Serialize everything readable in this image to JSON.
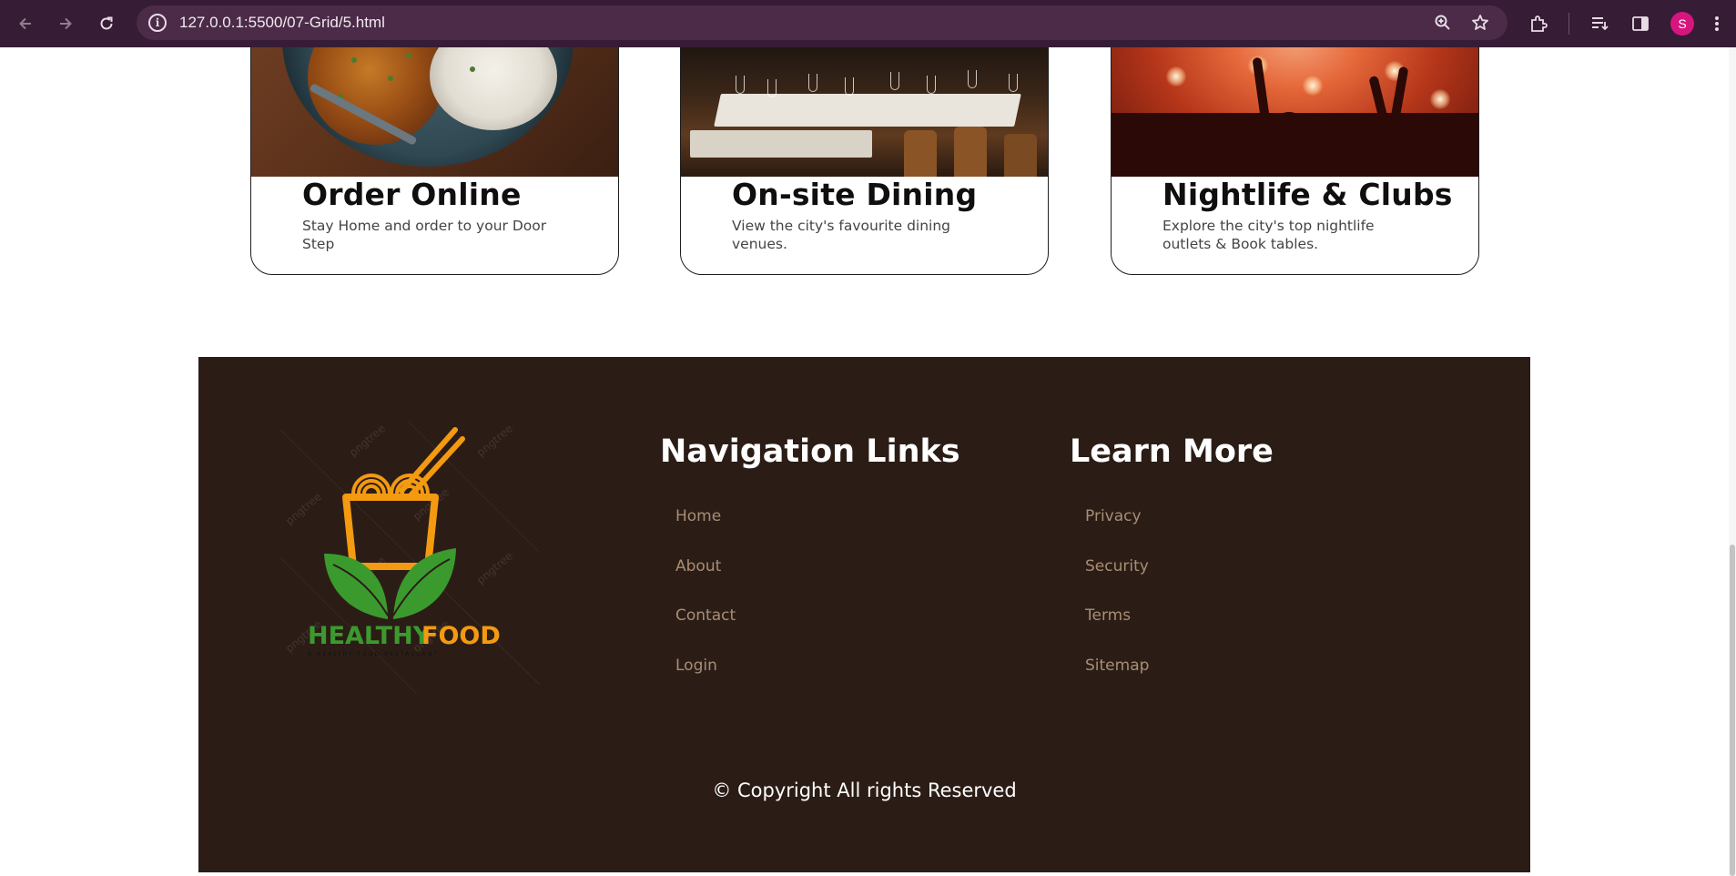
{
  "browser": {
    "url": "127.0.0.1:5500/07-Grid/5.html",
    "profile_initial": "S",
    "icons": [
      "back-icon",
      "forward-icon",
      "reload-icon",
      "site-info-icon",
      "zoom-icon",
      "bookmark-star-icon",
      "extensions-icon",
      "reading-list-icon",
      "side-panel-icon",
      "menu-icon"
    ],
    "avatar_color": "#d7157f"
  },
  "cards": [
    {
      "title": "Order Online",
      "description": "Stay Home and order to your Door Step"
    },
    {
      "title": "On-site Dining",
      "description": "View the city's favourite dining venues."
    },
    {
      "title": "Nightlife & Clubs",
      "description": "Explore the city's top nightlife outlets & Book tables."
    }
  ],
  "footer": {
    "logo": {
      "brand_green": "HEALTHY",
      "brand_orange": "FOOD",
      "tagline": "A HEALTHY FOOD RESTAURANT",
      "watermark": "pngtree"
    },
    "nav_title": "Navigation Links",
    "nav_links": [
      "Home",
      "About",
      "Contact",
      "Login"
    ],
    "learn_title": "Learn More",
    "learn_links": [
      "Privacy",
      "Security",
      "Terms",
      "Sitemap"
    ],
    "copyright": "© Copyright All rights Reserved"
  },
  "colors": {
    "chrome_bg": "#371c35",
    "footer_bg": "#2b1d16",
    "footer_link": "#a88d75",
    "logo_green": "#3b9a2e",
    "logo_orange": "#f39a11"
  }
}
